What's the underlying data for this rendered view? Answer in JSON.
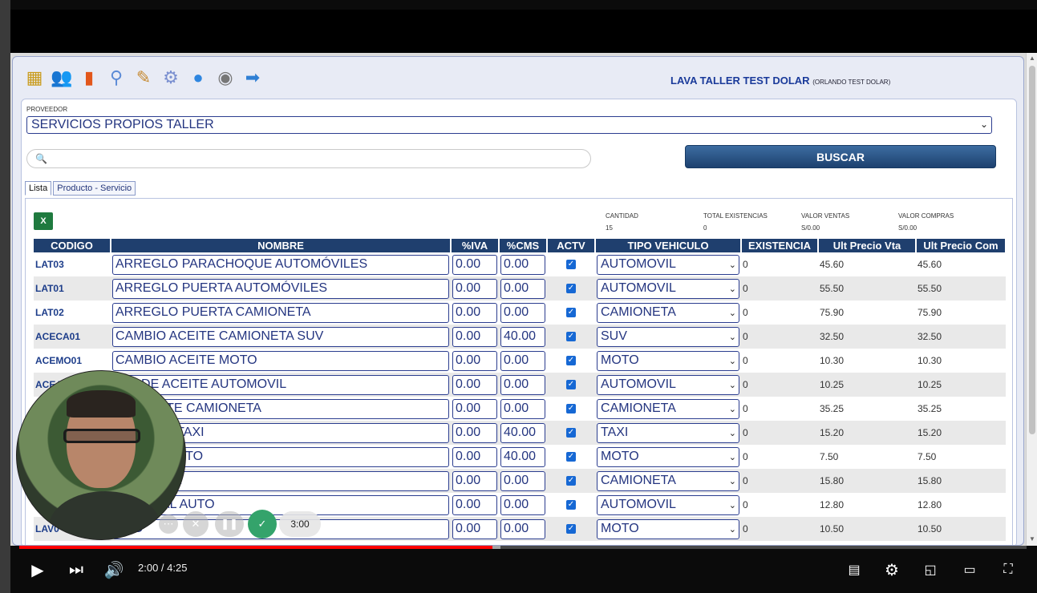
{
  "app": {
    "company_name": "LAVA TALLER TEST DOLAR",
    "company_owner": "(ORLANDO TEST DOLAR)",
    "toolbar_icons": [
      "cash-register-icon",
      "users-icon",
      "bar-chart-icon",
      "search-icon",
      "notes-icon",
      "gear-icon",
      "magnifier-icon",
      "user-circle-icon",
      "arrow-right-icon"
    ]
  },
  "form": {
    "proveedor_label": "PROVEEDOR",
    "proveedor_value": "SERVICIOS PROPIOS TALLER",
    "search_value": "",
    "buscar_label": "BUSCAR"
  },
  "tabs": [
    "Lista",
    "Producto - Servicio"
  ],
  "stats": {
    "cantidad_label": "CANTIDAD",
    "cantidad_value": "15",
    "existencias_label": "TOTAL EXISTENCIAS",
    "existencias_value": "0",
    "ventas_label": "VALOR VENTAS",
    "ventas_value": "S/0.00",
    "compras_label": "VALOR COMPRAS",
    "compras_value": "S/0.00"
  },
  "table": {
    "headers": [
      "CODIGO",
      "NOMBRE",
      "%IVA",
      "%CMS",
      "ACTV",
      "TIPO VEHICULO",
      "EXISTENCIA",
      "Ult Precio Vta",
      "Ult Precio Com"
    ],
    "rows": [
      {
        "code": "LAT03",
        "name": "ARREGLO PARACHOQUE AUTOMÓVILES",
        "iva": "0.00",
        "cms": "0.00",
        "tipo": "AUTOMOVIL",
        "exist": "0",
        "vta": "45.60",
        "com": "45.60"
      },
      {
        "code": "LAT01",
        "name": "ARREGLO PUERTA AUTOMÓVILES",
        "iva": "0.00",
        "cms": "0.00",
        "tipo": "AUTOMOVIL",
        "exist": "0",
        "vta": "55.50",
        "com": "55.50"
      },
      {
        "code": "LAT02",
        "name": "ARREGLO PUERTA CAMIONETA",
        "iva": "0.00",
        "cms": "0.00",
        "tipo": "CAMIONETA",
        "exist": "0",
        "vta": "75.90",
        "com": "75.90"
      },
      {
        "code": "ACECA01",
        "name": "CAMBIO ACEITE CAMIONETA SUV",
        "iva": "0.00",
        "cms": "40.00",
        "tipo": "SUV",
        "exist": "0",
        "vta": "32.50",
        "com": "32.50"
      },
      {
        "code": "ACEMO01",
        "name": "CAMBIO ACEITE MOTO",
        "iva": "0.00",
        "cms": "0.00",
        "tipo": "MOTO",
        "exist": "0",
        "vta": "10.30",
        "com": "10.30"
      },
      {
        "code": "ACEA",
        "name": "BIO DE ACEITE AUTOMOVIL",
        "iva": "0.00",
        "cms": "0.00",
        "tipo": "AUTOMOVIL",
        "exist": "0",
        "vta": "10.25",
        "com": "10.25"
      },
      {
        "code": "",
        "name": "DE ACEITE CAMIONETA",
        "iva": "0.00",
        "cms": "0.00",
        "tipo": "CAMIONETA",
        "exist": "0",
        "vta": "35.25",
        "com": "35.25"
      },
      {
        "code": "",
        "name": "E ACEITE TAXI",
        "iva": "0.00",
        "cms": "40.00",
        "tipo": "TAXI",
        "exist": "0",
        "vta": "15.20",
        "com": "15.20"
      },
      {
        "code": "",
        "name": "RENOS MOTO",
        "iva": "0.00",
        "cms": "40.00",
        "tipo": "MOTO",
        "exist": "0",
        "vta": "7.50",
        "com": "7.50"
      },
      {
        "code": "",
        "name": "AMIONETA",
        "iva": "0.00",
        "cms": "0.00",
        "tipo": "CAMIONETA",
        "exist": "0",
        "vta": "15.80",
        "com": "15.80"
      },
      {
        "code": "",
        "name": "GENERAL AUTO",
        "iva": "0.00",
        "cms": "0.00",
        "tipo": "AUTOMOVIL",
        "exist": "0",
        "vta": "12.80",
        "com": "12.80"
      },
      {
        "code": "LAV0",
        "name": "ADC",
        "iva": "0.00",
        "cms": "0.00",
        "tipo": "MOTO",
        "exist": "0",
        "vta": "10.50",
        "com": "10.50"
      }
    ]
  },
  "recorder": {
    "timer": "3:00"
  },
  "video": {
    "time": "2:00 / 4:25",
    "progress_fraction": 0.47
  }
}
